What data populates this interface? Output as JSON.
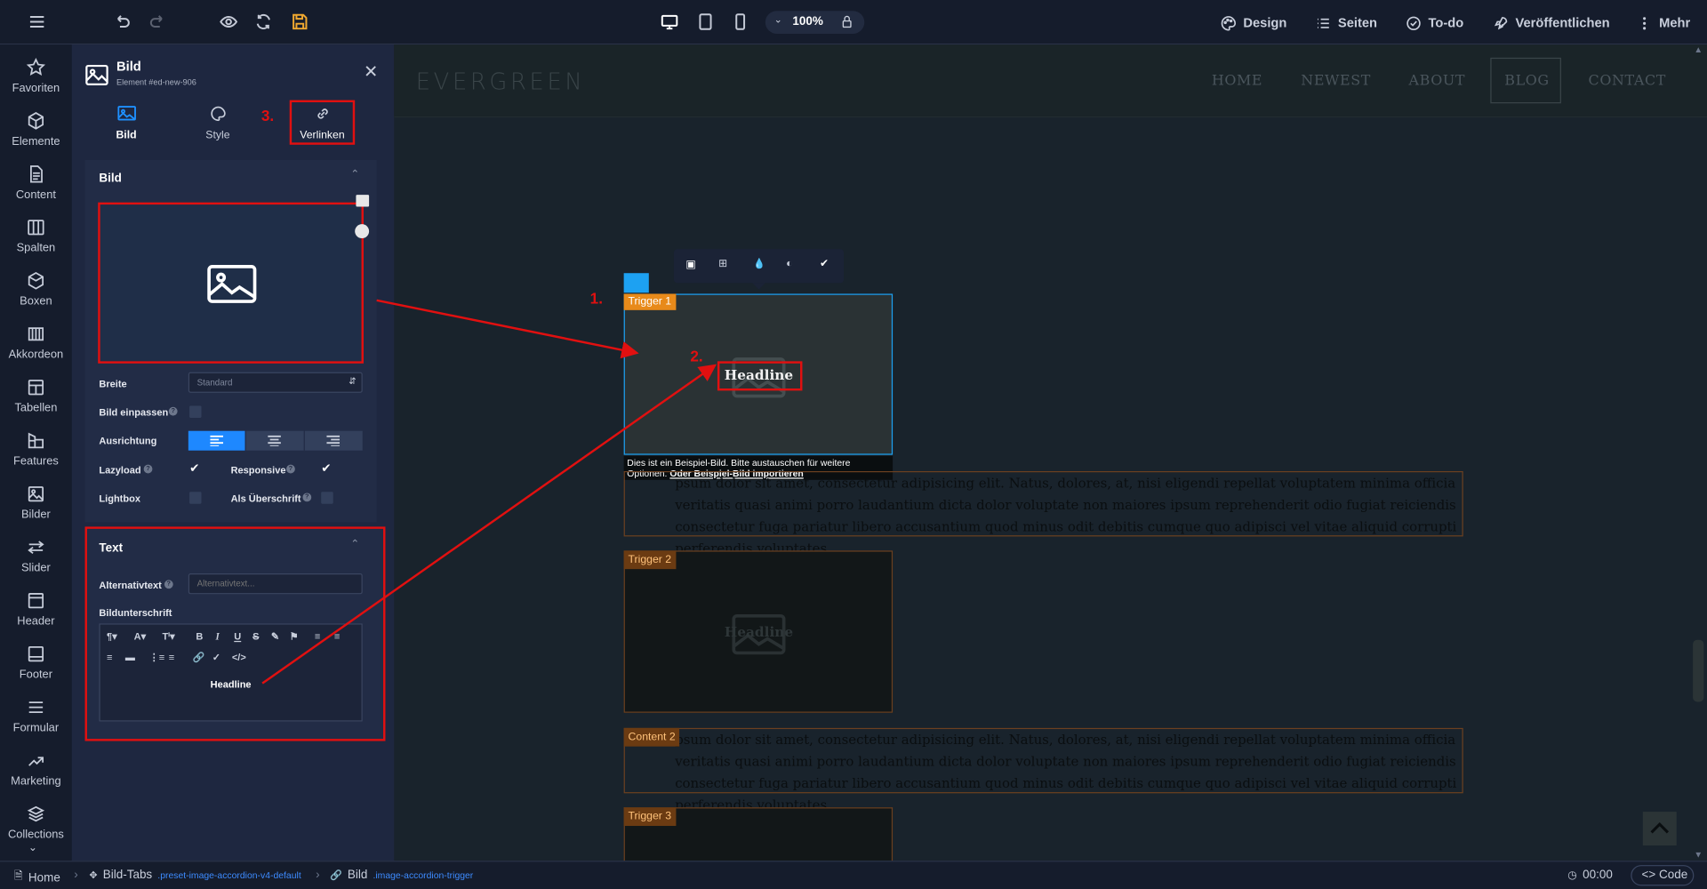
{
  "topbar": {
    "zoom": "100%",
    "items": [
      {
        "label": "Design",
        "icon": "palette-icon"
      },
      {
        "label": "Seiten",
        "icon": "list-icon"
      },
      {
        "label": "To-do",
        "icon": "check-circle-icon"
      },
      {
        "label": "Veröffentlichen",
        "icon": "rocket-icon"
      },
      {
        "label": "Mehr",
        "icon": "more-vertical-icon"
      }
    ],
    "accent": "#f0a830"
  },
  "rail": [
    {
      "label": "Favoriten",
      "icon": "star-icon"
    },
    {
      "label": "Elemente",
      "icon": "cube-icon"
    },
    {
      "label": "Content",
      "icon": "document-icon"
    },
    {
      "label": "Spalten",
      "icon": "columns-icon"
    },
    {
      "label": "Boxen",
      "icon": "box-icon"
    },
    {
      "label": "Akkordeon",
      "icon": "accordion-icon"
    },
    {
      "label": "Tabellen",
      "icon": "table-icon"
    },
    {
      "label": "Features",
      "icon": "features-icon"
    },
    {
      "label": "Bilder",
      "icon": "image-icon"
    },
    {
      "label": "Slider",
      "icon": "slider-icon"
    },
    {
      "label": "Header",
      "icon": "header-icon"
    },
    {
      "label": "Footer",
      "icon": "footer-icon"
    },
    {
      "label": "Formular",
      "icon": "form-icon"
    },
    {
      "label": "Marketing",
      "icon": "chart-up-icon"
    },
    {
      "label": "Collections",
      "icon": "layers-icon"
    }
  ],
  "panel": {
    "title": "Bild",
    "element_id": "Element #ed-new-906",
    "tabs": [
      {
        "label": "Bild",
        "icon": "image-icon",
        "active": true
      },
      {
        "label": "Style",
        "icon": "palette-icon",
        "active": false
      },
      {
        "label": "Verlinken",
        "icon": "link-icon",
        "active": false
      }
    ],
    "step3": "3.",
    "bild_section": {
      "title": "Bild",
      "breite_label": "Breite",
      "breite_value": "Standard",
      "einpassen_label": "Bild einpassen",
      "ausrichtung_label": "Ausrichtung",
      "lazyload_label": "Lazyload",
      "lazyload_checked": true,
      "responsive_label": "Responsive",
      "responsive_checked": true,
      "lightbox_label": "Lightbox",
      "lightbox_checked": false,
      "ueberschrift_label": "Als Überschrift",
      "ueberschrift_checked": false
    },
    "text_section": {
      "title": "Text",
      "alt_label": "Alternativtext",
      "alt_placeholder": "Alternativtext...",
      "caption_label": "Bildunterschrift",
      "caption_value": "Headline"
    }
  },
  "canvas": {
    "logo": "EVERGREEN",
    "nav": [
      "HOME",
      "NEWEST",
      "ABOUT",
      "BLOG",
      "CONTACT"
    ],
    "active_nav": "BLOG",
    "step1": "1.",
    "step2": "2.",
    "trigger1": "Trigger 1",
    "trigger2": "Trigger 2",
    "trigger3": "Trigger 3",
    "content2": "Content 2",
    "headline": "Headline",
    "sample_notice": "Dies ist ein Beispiel-Bild. Bitte austauschen für weitere Optionen.",
    "sample_link": "Oder Beispiel-Bild importieren",
    "para1": "psum dolor sit amet, consectetur adipisicing elit. Natus, dolores, at, nisi eligendi repellat voluptatem minima officia veritatis quasi animi porro laudantium dicta dolor voluptate non maiores ipsum reprehenderit odio fugiat reiciendis consectetur fuga pariatur libero accusantium quod minus odit debitis cumque quo adipisci vel vitae aliquid corrupti perferendis voluptates.",
    "para2": "psum dolor sit amet, consectetur adipisicing elit. Natus, dolores, at, nisi eligendi repellat voluptatem minima officia veritatis quasi animi porro laudantium dicta dolor voluptate non maiores ipsum reprehenderit odio fugiat reiciendis consectetur fuga pariatur libero accusantium quod minus odit debitis cumque quo adipisci vel vitae aliquid corrupti perferendis voluptates."
  },
  "status": {
    "home": "Home",
    "crumb1": "Bild-Tabs",
    "crumb1_class": ".preset-image-accordion-v4-default",
    "crumb2": "Bild",
    "crumb2_class": ".image-accordion-trigger",
    "time": "00:00",
    "code": "Code"
  }
}
